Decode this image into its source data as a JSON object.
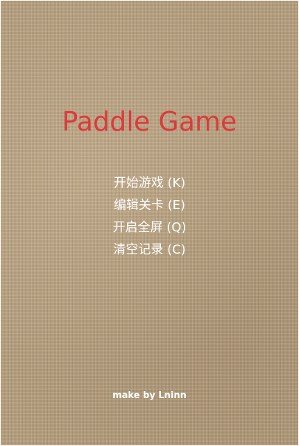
{
  "game": {
    "title": "Paddle Game",
    "title_color": "#dc3a3c",
    "background_color": "#b9a281",
    "menu_color": "#ffffff"
  },
  "menu": {
    "items": [
      {
        "label": "开始游戏 (K)",
        "hotkey": "K"
      },
      {
        "label": "编辑关卡 (E)",
        "hotkey": "E"
      },
      {
        "label": "开启全屏 (Q)",
        "hotkey": "Q"
      },
      {
        "label": "清空记录 (C)",
        "hotkey": "C"
      }
    ]
  },
  "footer": {
    "credit": "make by Lninn"
  }
}
